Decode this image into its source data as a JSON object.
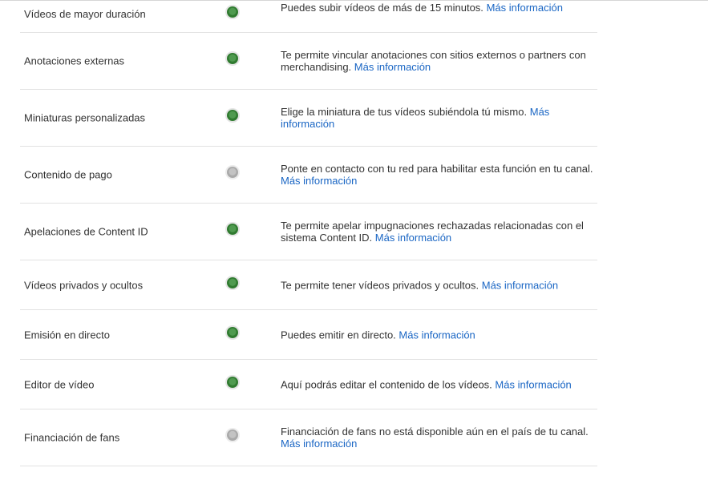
{
  "features": [
    {
      "name": "Vídeos de mayor duración",
      "status": "enabled",
      "description": "Puedes subir vídeos de más de 15 minutos.",
      "link": "Más información"
    },
    {
      "name": "Anotaciones externas",
      "status": "enabled",
      "description": "Te permite vincular anotaciones con sitios externos o partners con merchandising.",
      "link": "Más información"
    },
    {
      "name": "Miniaturas personalizadas",
      "status": "enabled",
      "description": "Elige la miniatura de tus vídeos subiéndola tú mismo.",
      "link": "Más información"
    },
    {
      "name": "Contenido de pago",
      "status": "disabled",
      "description": "Ponte en contacto con tu red para habilitar esta función en tu canal.",
      "link": "Más información"
    },
    {
      "name": "Apelaciones de Content ID",
      "status": "enabled",
      "description": "Te permite apelar impugnaciones rechazadas relacionadas con el sistema Content ID.",
      "link": "Más información"
    },
    {
      "name": "Vídeos privados y ocultos",
      "status": "enabled",
      "description": "Te permite tener vídeos privados y ocultos.",
      "link": "Más información"
    },
    {
      "name": "Emisión en directo",
      "status": "enabled",
      "description": "Puedes emitir en directo.",
      "link": "Más información"
    },
    {
      "name": "Editor de vídeo",
      "status": "enabled",
      "description": "Aquí podrás editar el contenido de los vídeos.",
      "link": "Más información"
    },
    {
      "name": "Financiación de fans",
      "status": "disabled",
      "description": "Financiación de fans no está disponible aún en el país de tu canal.",
      "link": "Más información"
    }
  ]
}
